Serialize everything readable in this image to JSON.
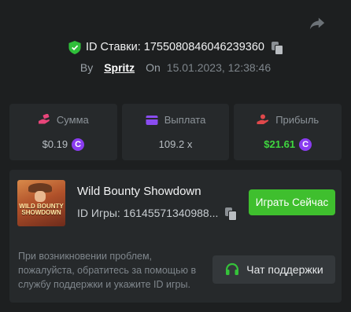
{
  "bet": {
    "id_label": "ID Ставки: 1755080846046239360",
    "by_label": "By",
    "username": "Spritz",
    "on_label": "On",
    "date": "15.01.2023, 12:38:46"
  },
  "stats": [
    {
      "icon": "money-hand-icon",
      "label": "Сумма",
      "value": "$0.19",
      "currency_symbol": "C",
      "icon_color": "#e8457a"
    },
    {
      "icon": "wallet-icon",
      "label": "Выплата",
      "value": "109.2 x",
      "icon_color": "#8a4cf0"
    },
    {
      "icon": "profit-icon",
      "label": "Прибыль",
      "value": "$21.61",
      "currency_symbol": "C",
      "icon_color": "#e0484b",
      "value_color": "#3fd63f"
    }
  ],
  "game": {
    "name": "Wild Bounty Showdown",
    "id_label": "ID Игры: 16145571340988...",
    "thumbnail_title": "WILD BOUNTY SHOWDOWN",
    "play_label": "Играть Сейчас"
  },
  "support": {
    "help_text": "При возникновении проблем, пожалуйста, обратитесь за помощью в службу поддержки и укажите ID игры.",
    "button_label": "Чат поддержки"
  },
  "colors": {
    "background": "#1d1f20",
    "card": "#26292b",
    "accent_green": "#3fbf2e",
    "coin_purple": "#8a3cf0"
  }
}
